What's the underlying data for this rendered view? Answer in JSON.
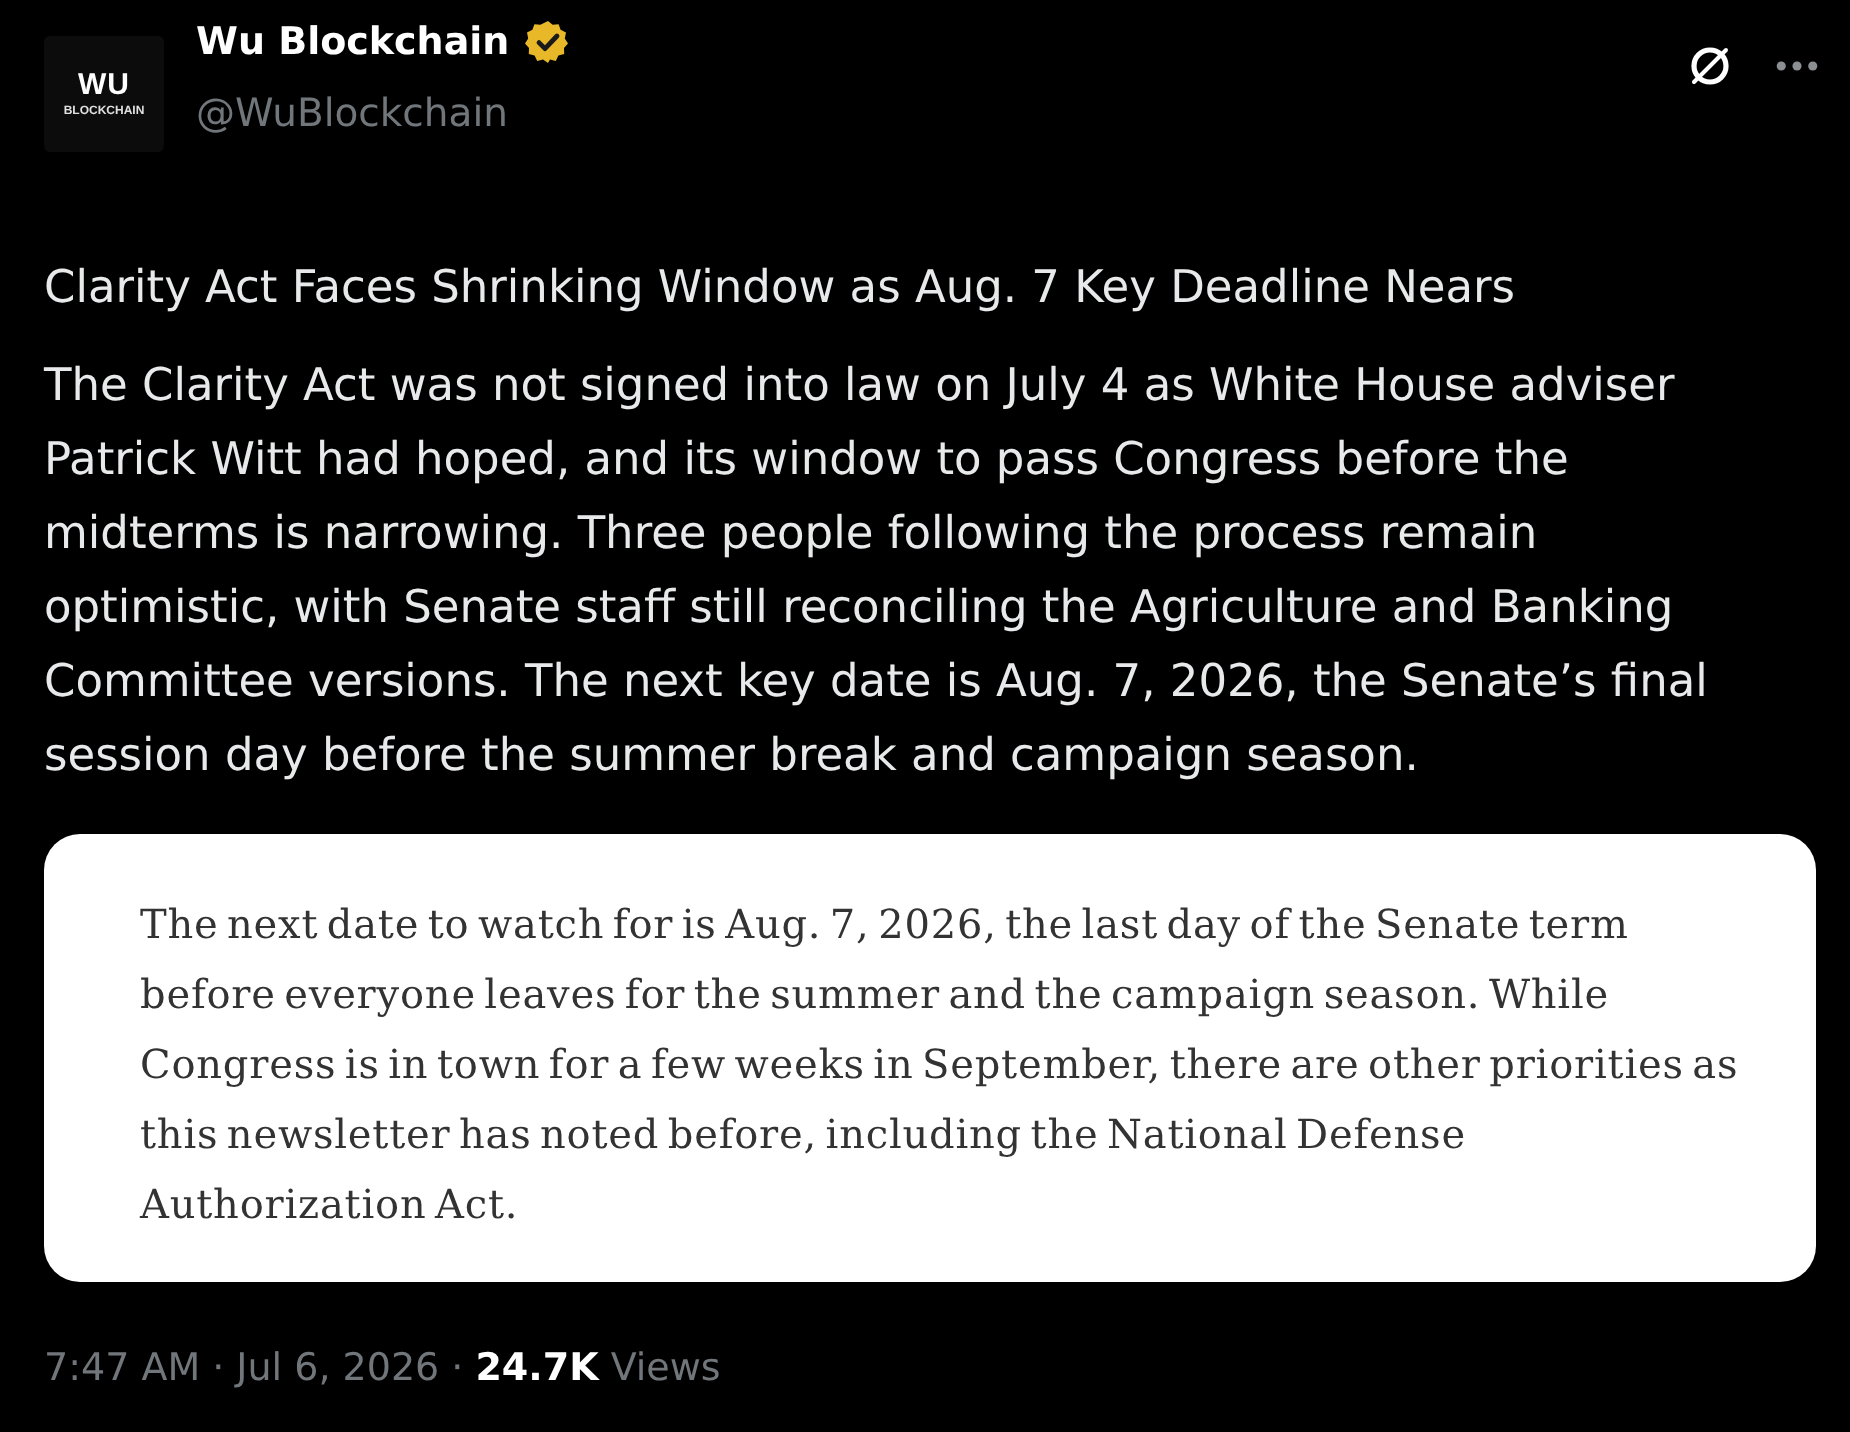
{
  "author": {
    "avatar": {
      "logo_line_1": "WU",
      "logo_line_2": "BLOCKCHAIN"
    },
    "name": "Wu Blockchain",
    "verified": true,
    "handle": "@WuBlockchain"
  },
  "post": {
    "title": "Clarity Act Faces Shrinking Window as Aug. 7 Key Deadline Nears",
    "body": "The Clarity Act was not signed into law on July 4 as White House adviser Patrick Witt had hoped, and its window to pass Congress before the midterms is narrowing. Three people following the process remain optimistic, with Senate staff still reconciling the Agriculture and Banking Committee versions. The next key date is Aug. 7, 2026, the Senate’s final session day before the summer break and campaign season.",
    "quote_image": {
      "text": "The next date to watch for is Aug. 7, 2026, the last day of the Senate term before everyone leaves for the summer and the campaign season. While Congress is in town for a few weeks in September, there are other priorities as this newsletter has noted before, including the National Defense Authorization Act."
    }
  },
  "meta": {
    "time": "7:47 AM",
    "separator_1": "·",
    "date": "Jul 6, 2026",
    "separator_2": "·",
    "views_count": "24.7K",
    "views_label": "Views"
  }
}
